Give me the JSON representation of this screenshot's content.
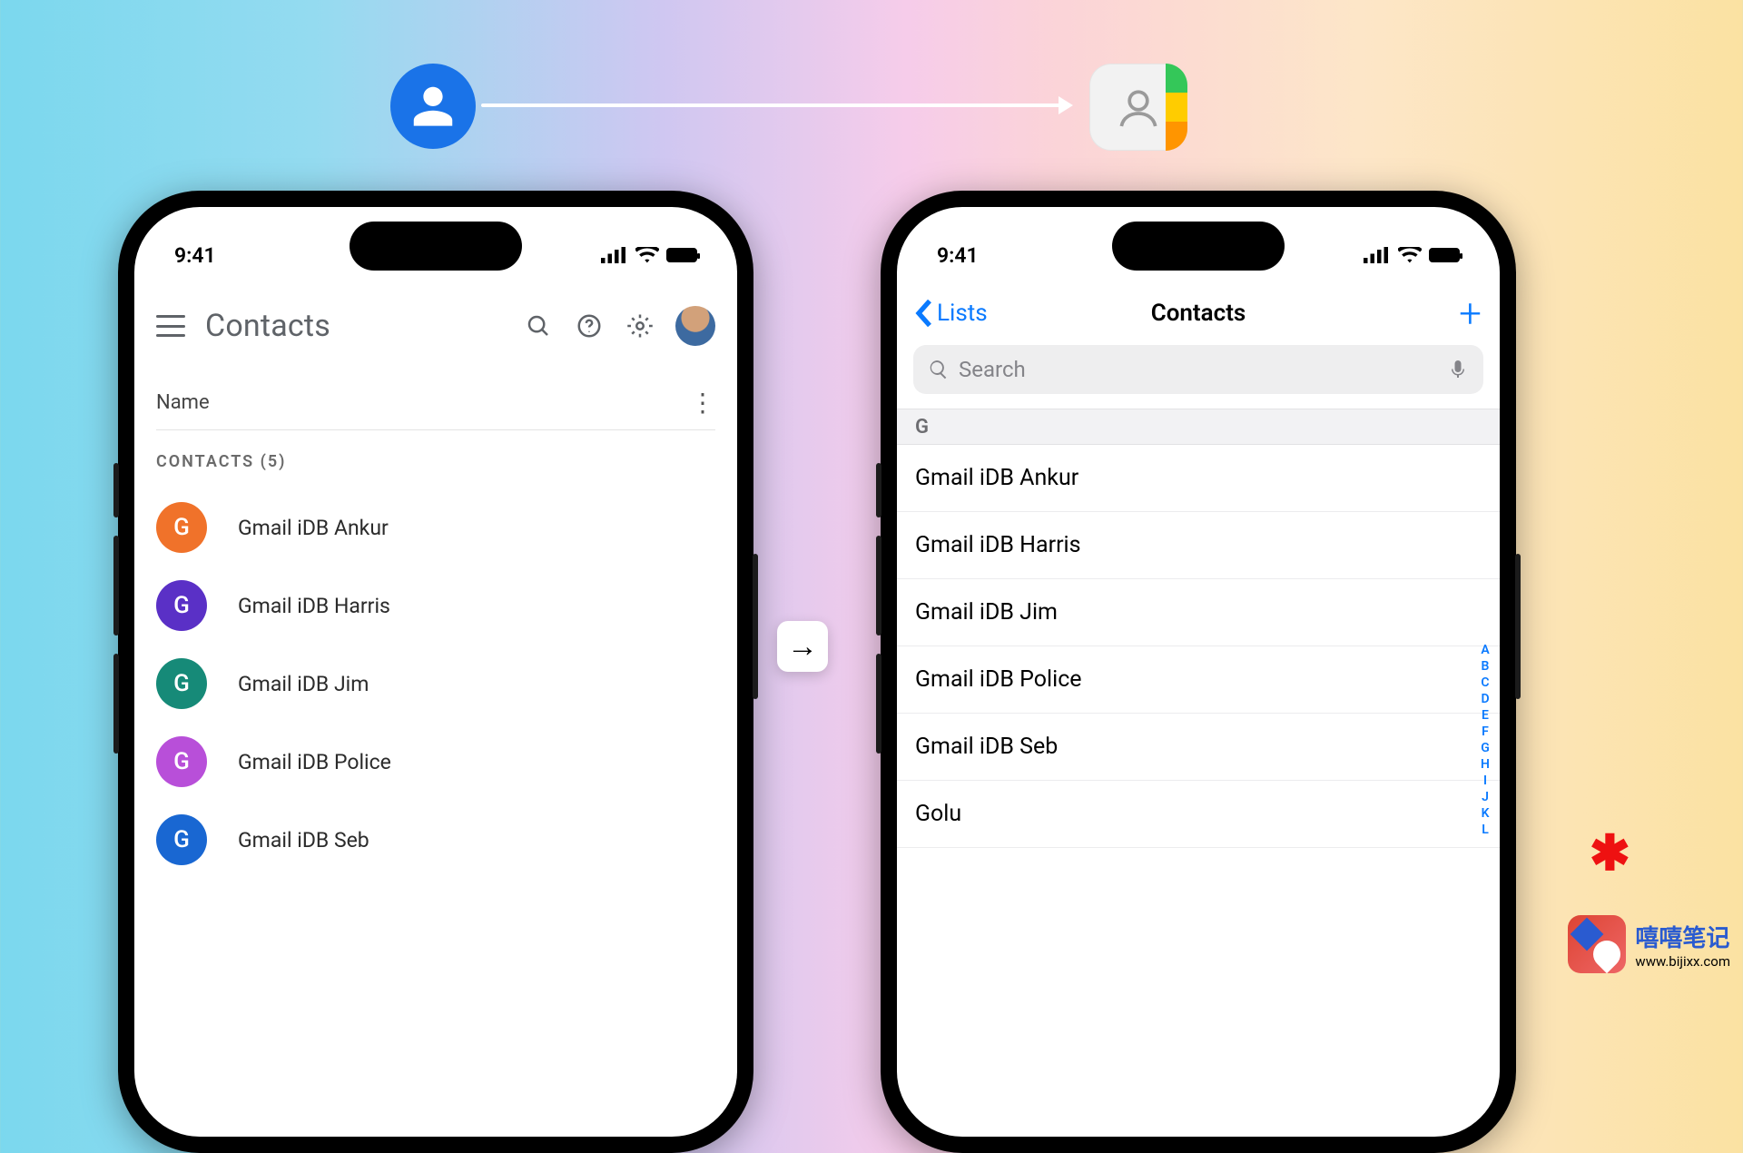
{
  "status_time": "9:41",
  "google": {
    "title": "Contacts",
    "column_label": "Name",
    "count_label": "CONTACTS (5)",
    "avatar_letter": "G",
    "contacts": [
      {
        "name": "Gmail iDB Ankur",
        "color": "#f0722a"
      },
      {
        "name": "Gmail iDB Harris",
        "color": "#5a30c6"
      },
      {
        "name": "Gmail iDB Jim",
        "color": "#168a78"
      },
      {
        "name": "Gmail iDB Police",
        "color": "#b84fd9"
      },
      {
        "name": "Gmail iDB Seb",
        "color": "#1967d2"
      }
    ]
  },
  "ios": {
    "back_label": "Lists",
    "title": "Contacts",
    "search_placeholder": "Search",
    "section": "G",
    "contacts": [
      "Gmail iDB Ankur",
      "Gmail iDB Harris",
      "Gmail iDB Jim",
      "Gmail iDB Police",
      "Gmail iDB Seb",
      "Golu"
    ],
    "index_letters": [
      "A",
      "B",
      "C",
      "D",
      "E",
      "F",
      "G",
      "H",
      "I",
      "J",
      "K",
      "L"
    ]
  },
  "watermark": {
    "name": "嘻嘻笔记",
    "url": "www.bijixx.com"
  }
}
